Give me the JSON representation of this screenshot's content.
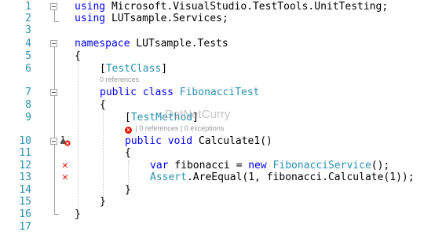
{
  "line_numbers": [
    "1",
    "2",
    "3",
    "4",
    "5",
    "6",
    "7",
    "8",
    "9",
    "10",
    "11",
    "12",
    "13",
    "14",
    "15",
    "16",
    "17"
  ],
  "code": {
    "l1_kw": "using",
    "l1_rest": " Microsoft.VisualStudio.TestTools.UnitTesting;",
    "l2_kw": "using",
    "l2_rest": " LUTsample.Services;",
    "l4_kw": "namespace",
    "l4_rest": " LUTsample.Tests",
    "l5": "{",
    "l6_open": "[",
    "l6_type": "TestClass",
    "l6_close": "]",
    "l6_lens": "0 references",
    "l7_kw1": "public",
    "l7_kw2": "class",
    "l7_type": "FibonacciTest",
    "l8": "{",
    "l9_open": "[",
    "l9_type": "TestMethod",
    "l9_close": "]",
    "l9_lens_icon": "x",
    "l9_lens": " | 0 references | 0 exceptions",
    "l10_kw1": "public",
    "l10_kw2": "void",
    "l10_rest": " Calculate1()",
    "l11": "{",
    "l12_kw1": "var",
    "l12_mid": " fibonacci = ",
    "l12_kw2": "new",
    "l12_type": "FibonacciService",
    "l12_end": "();",
    "l13_type": "Assert",
    "l13_rest": ".AreEqual(1, fibonacci.Calculate(1));",
    "l14": "}",
    "l15": "}",
    "l16": "}"
  },
  "glyphs": {
    "fail_mark": "✕"
  },
  "watermark": "DotNetCurry",
  "colors": {
    "keyword": "#0000ff",
    "type": "#2b91af",
    "line_number": "#2b91af",
    "error": "#e51400"
  }
}
